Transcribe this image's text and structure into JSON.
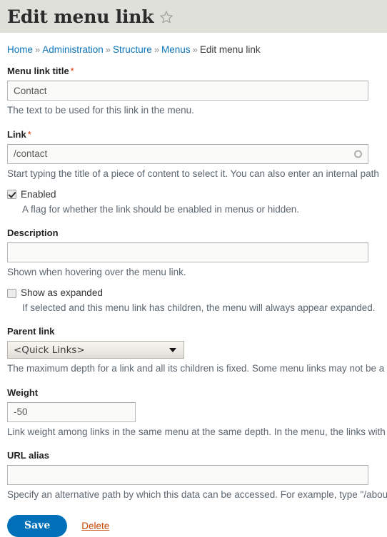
{
  "header": {
    "title": "Edit menu link",
    "star_icon": "star-outline-icon"
  },
  "breadcrumb": {
    "separator": "»",
    "items": [
      {
        "label": "Home",
        "is_link": true
      },
      {
        "label": "Administration",
        "is_link": true
      },
      {
        "label": "Structure",
        "is_link": true
      },
      {
        "label": "Menus",
        "is_link": true
      },
      {
        "label": "Edit menu link",
        "is_link": false
      }
    ]
  },
  "form": {
    "menu_link_title": {
      "label": "Menu link title",
      "required_mark": "*",
      "value": "Contact",
      "placeholder": "",
      "description": "The text to be used for this link in the menu."
    },
    "link": {
      "label": "Link",
      "required_mark": "*",
      "value": "/contact",
      "placeholder": "",
      "description": "Start typing the title of a piece of content to select it. You can also enter an internal path",
      "throbber_icon": "autocomplete-throbber-icon"
    },
    "enabled": {
      "label": "Enabled",
      "checked": true,
      "description": "A flag for whether the link should be enabled in menus or hidden."
    },
    "description_field": {
      "label": "Description",
      "value": "",
      "placeholder": "",
      "description": "Shown when hovering over the menu link."
    },
    "show_as_expanded": {
      "label": "Show as expanded",
      "checked": false,
      "description": "If selected and this menu link has children, the menu will always appear expanded."
    },
    "parent_link": {
      "label": "Parent link",
      "selected": "<Quick Links>",
      "options": [
        "<Quick Links>"
      ],
      "arrow_icon": "chevron-down-icon",
      "description": "The maximum depth for a link and all its children is fixed. Some menu links may not be a"
    },
    "weight": {
      "label": "Weight",
      "value": "-50",
      "placeholder": "",
      "description": "Link weight among links in the same menu at the same depth. In the menu, the links with"
    },
    "url_alias": {
      "label": "URL alias",
      "value": "",
      "placeholder": "",
      "description": "Specify an alternative path by which this data can be accessed. For example, type \"/abou"
    }
  },
  "actions": {
    "save_label": "Save",
    "delete_label": "Delete"
  },
  "colors": {
    "header_background": "#e0e0db",
    "link_blue": "#0c74b8",
    "required_red": "#e02d00",
    "primary_button": "#0071b8",
    "delete_link": "#c64600"
  }
}
